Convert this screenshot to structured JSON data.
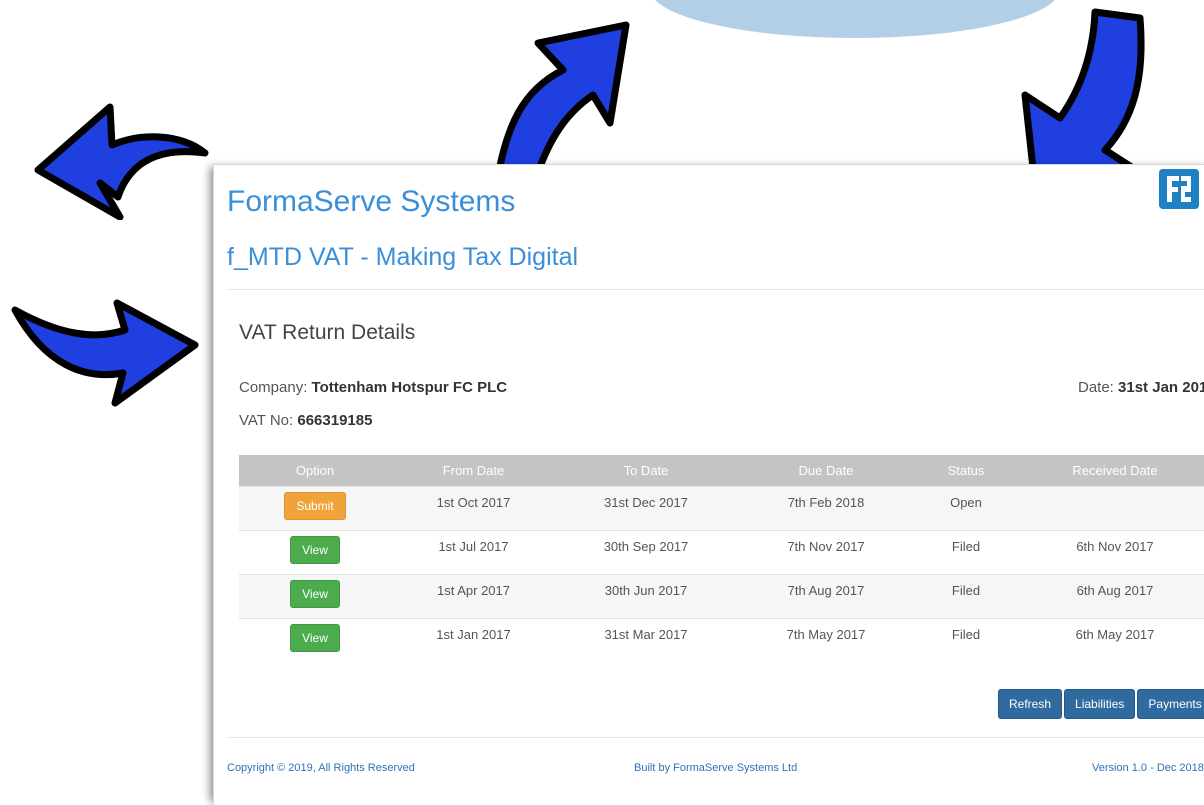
{
  "header": {
    "brand": "FormaServe Systems",
    "subtitle": "f_MTD VAT - Making Tax Digital",
    "logo_text": "FS"
  },
  "section": {
    "title": "VAT Return Details",
    "company_label": "Company:",
    "company_value": "Tottenham Hotspur FC PLC",
    "vat_label": "VAT No:",
    "vat_value": "666319185",
    "date_label": "Date:",
    "date_value": "31st Jan 201"
  },
  "table": {
    "headers": [
      "Option",
      "From Date",
      "To Date",
      "Due Date",
      "Status",
      "Received Date"
    ],
    "rows": [
      {
        "option": "Submit",
        "from": "1st Oct 2017",
        "to": "31st Dec 2017",
        "due": "7th Feb 2018",
        "status": "Open",
        "received": ""
      },
      {
        "option": "View",
        "from": "1st Jul 2017",
        "to": "30th Sep 2017",
        "due": "7th Nov 2017",
        "status": "Filed",
        "received": "6th Nov 2017"
      },
      {
        "option": "View",
        "from": "1st Apr 2017",
        "to": "30th Jun 2017",
        "due": "7th Aug 2017",
        "status": "Filed",
        "received": "6th Aug 2017"
      },
      {
        "option": "View",
        "from": "1st Jan 2017",
        "to": "31st Mar 2017",
        "due": "7th May 2017",
        "status": "Filed",
        "received": "6th May 2017"
      }
    ]
  },
  "actions": {
    "refresh": "Refresh",
    "liabilities": "Liabilities",
    "payments": "Payments"
  },
  "footer": {
    "copyright": "Copyright © 2019, All Rights Reserved",
    "built_by": "Built by FormaServe Systems Ltd",
    "version": "Version 1.0 - Dec 2018"
  },
  "colors": {
    "brand_blue": "#3a8fd9",
    "arrow_blue": "#1f3fe0",
    "submit_orange": "#f0a33b",
    "view_green": "#4cab4c",
    "action_blue": "#2f6b9e"
  }
}
